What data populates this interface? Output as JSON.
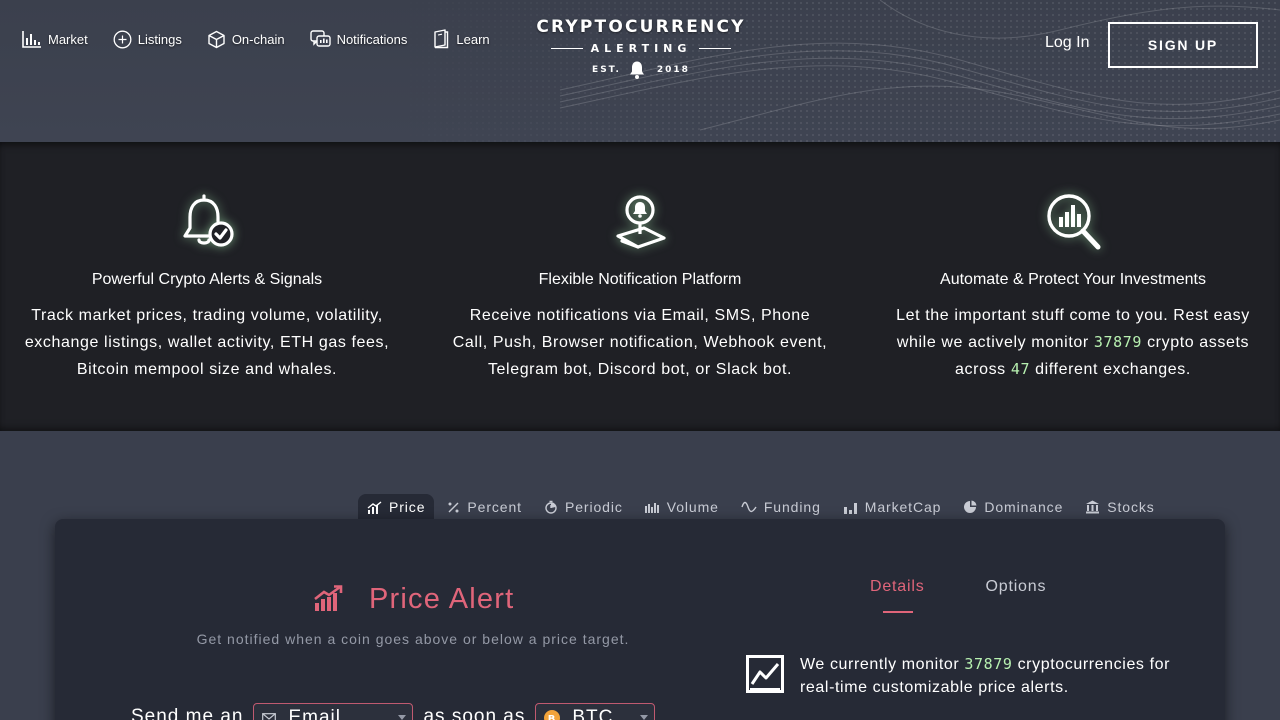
{
  "header": {
    "nav": [
      {
        "label": "Market",
        "icon": "bar-chart-icon"
      },
      {
        "label": "Listings",
        "icon": "plus-circle-icon"
      },
      {
        "label": "On-chain",
        "icon": "cube-icon"
      },
      {
        "label": "Notifications",
        "icon": "chat-bubbles-icon"
      },
      {
        "label": "Learn",
        "icon": "book-icon"
      }
    ],
    "logo": {
      "line1": "CRYPTOCURRENCY",
      "line2": "ALERTING",
      "est": "EST.",
      "year": "2018"
    },
    "login_label": "Log In",
    "signup_label": "SIGN UP"
  },
  "features": [
    {
      "icon": "bell-check-icon",
      "title": "Powerful Crypto Alerts & Signals",
      "desc": "Track market prices, trading volume, volatility, exchange listings, wallet activity, ETH gas fees, Bitcoin mempool size and whales."
    },
    {
      "icon": "phone-bell-icon",
      "title": "Flexible Notification Platform",
      "desc": "Receive notifications via Email, SMS, Phone Call, Push, Browser notification, Webhook event, Telegram bot, Discord bot, or Slack bot."
    },
    {
      "icon": "magnifier-chart-icon",
      "title": "Automate & Protect Your Investments",
      "desc_a": "Let the important stuff come to you. Rest easy while we actively monitor",
      "asset_count": "37879",
      "desc_b": "crypto assets across",
      "exchange_count": "47",
      "desc_c": "different exchanges."
    }
  ],
  "tabs": [
    {
      "label": "Price",
      "icon": "price-chart-icon",
      "active": true
    },
    {
      "label": "Percent",
      "icon": "percent-icon"
    },
    {
      "label": "Periodic",
      "icon": "stopwatch-icon"
    },
    {
      "label": "Volume",
      "icon": "volume-bars-icon"
    },
    {
      "label": "Funding",
      "icon": "wave-icon"
    },
    {
      "label": "MarketCap",
      "icon": "bar-chart-icon"
    },
    {
      "label": "Dominance",
      "icon": "pie-chart-icon"
    },
    {
      "label": "Stocks",
      "icon": "bank-icon"
    }
  ],
  "alert": {
    "title": "Price Alert",
    "subtitle": "Get notified when a coin goes above or below a price target.",
    "send_prefix": "Send me an",
    "channel_value": "Email",
    "connector": "as soon as",
    "coin_value": "BTC"
  },
  "details": {
    "tabs": [
      {
        "label": "Details",
        "active": true
      },
      {
        "label": "Options"
      }
    ],
    "monitor_a": "We currently monitor",
    "monitor_count": "37879",
    "monitor_b": "cryptocurrencies for real-time customizable price alerts."
  },
  "colors": {
    "accent": "#e0657a",
    "highlight": "#b7f0b0",
    "dark_band": "#1f2025",
    "card": "#262a36"
  }
}
